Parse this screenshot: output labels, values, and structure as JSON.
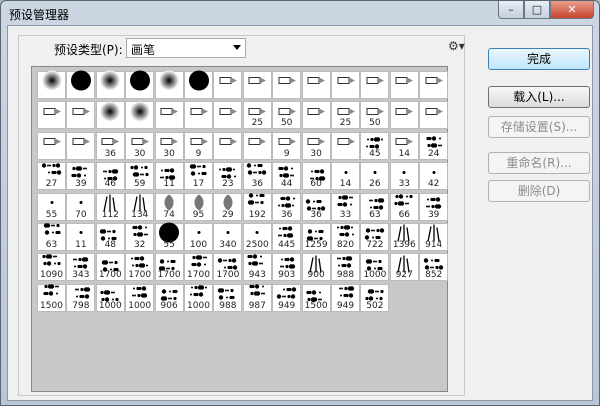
{
  "window": {
    "title": "预设管理器"
  },
  "titlebar": {
    "min_glyph": "–",
    "max_glyph": "□",
    "close_glyph": "✕"
  },
  "type": {
    "label": "预设类型(P):",
    "selected": "画笔",
    "gear_glyph": "⚙▾"
  },
  "buttons": {
    "done": "完成",
    "load": "载入(L)...",
    "save": "存储设置(S)...",
    "rename": "重命名(R)...",
    "delete": "删除(D)"
  },
  "brushes": [
    [
      "soft",
      ""
    ],
    [
      "hard",
      ""
    ],
    [
      "soft",
      ""
    ],
    [
      "hard",
      ""
    ],
    [
      "soft",
      ""
    ],
    [
      "hard",
      ""
    ],
    [
      "tip",
      ""
    ],
    [
      "tip",
      ""
    ],
    [
      "tip",
      ""
    ],
    [
      "tip",
      ""
    ],
    [
      "tip",
      ""
    ],
    [
      "tip",
      ""
    ],
    [
      "tip",
      ""
    ],
    [
      "tip",
      ""
    ],
    [
      "tip",
      ""
    ],
    [
      "tip",
      ""
    ],
    [
      "soft",
      ""
    ],
    [
      "soft",
      ""
    ],
    [
      "tip",
      ""
    ],
    [
      "tip",
      ""
    ],
    [
      "tip",
      ""
    ],
    [
      "tip",
      "25"
    ],
    [
      "tip",
      "50"
    ],
    [
      "tip",
      ""
    ],
    [
      "tip",
      "25"
    ],
    [
      "tip",
      "50"
    ],
    [
      "tip",
      ""
    ],
    [
      "tip",
      ""
    ],
    [
      "tip",
      ""
    ],
    [
      "tip",
      ""
    ],
    [
      "tip",
      "36"
    ],
    [
      "tip",
      "30"
    ],
    [
      "tip",
      "30"
    ],
    [
      "tip",
      "9"
    ],
    [
      "tip",
      ""
    ],
    [
      "tip",
      ""
    ],
    [
      "tip",
      "9"
    ],
    [
      "tip",
      "30"
    ],
    [
      "tip",
      ""
    ],
    [
      "spot",
      "45"
    ],
    [
      "tip",
      "14"
    ],
    [
      "spot",
      "24"
    ],
    [
      "spot",
      "27"
    ],
    [
      "spot",
      "39"
    ],
    [
      "spot",
      "46"
    ],
    [
      "spot",
      "59"
    ],
    [
      "spot",
      "11"
    ],
    [
      "spot",
      "17"
    ],
    [
      "spot",
      "23"
    ],
    [
      "spot",
      "36"
    ],
    [
      "spot",
      "44"
    ],
    [
      "spot",
      "60"
    ],
    [
      "dot",
      "14"
    ],
    [
      "dot",
      "26"
    ],
    [
      "dot",
      "33"
    ],
    [
      "dot",
      "42"
    ],
    [
      "dot",
      "55"
    ],
    [
      "dot",
      "70"
    ],
    [
      "grass",
      "112"
    ],
    [
      "grass",
      "134"
    ],
    [
      "leaf",
      "74"
    ],
    [
      "leaf",
      "95"
    ],
    [
      "leaf",
      "29"
    ],
    [
      "spot",
      "192"
    ],
    [
      "spot",
      "36"
    ],
    [
      "spot",
      "36"
    ],
    [
      "spot",
      "33"
    ],
    [
      "spot",
      "63"
    ],
    [
      "spot",
      "66"
    ],
    [
      "spot",
      "39"
    ],
    [
      "spot",
      "63"
    ],
    [
      "dot",
      "11"
    ],
    [
      "spot",
      "48"
    ],
    [
      "spot",
      "32"
    ],
    [
      "hard",
      "55"
    ],
    [
      "dot",
      "100"
    ],
    [
      "dot",
      "340"
    ],
    [
      "dot",
      "2500"
    ],
    [
      "spot",
      "445"
    ],
    [
      "spot",
      "1259"
    ],
    [
      "spot",
      "820"
    ],
    [
      "spot",
      "722"
    ],
    [
      "grass",
      "1396"
    ],
    [
      "grass",
      "914"
    ],
    [
      "spot",
      "1090"
    ],
    [
      "spot",
      "343"
    ],
    [
      "spot",
      "1700"
    ],
    [
      "spot",
      "1700"
    ],
    [
      "spot",
      "1700"
    ],
    [
      "spot",
      "1700"
    ],
    [
      "spot",
      "1700"
    ],
    [
      "spot",
      "943"
    ],
    [
      "spot",
      "903"
    ],
    [
      "grass",
      "900"
    ],
    [
      "spot",
      "988"
    ],
    [
      "spot",
      "1000"
    ],
    [
      "grass",
      "927"
    ],
    [
      "spot",
      "852"
    ],
    [
      "spot",
      "1500"
    ],
    [
      "spot",
      "798"
    ],
    [
      "spot",
      "1000"
    ],
    [
      "spot",
      "1000"
    ],
    [
      "spot",
      "906"
    ],
    [
      "spot",
      "1000"
    ],
    [
      "spot",
      "988"
    ],
    [
      "spot",
      "987"
    ],
    [
      "spot",
      "949"
    ],
    [
      "spot",
      "1500"
    ],
    [
      "spot",
      "949"
    ],
    [
      "spot",
      "502"
    ]
  ]
}
